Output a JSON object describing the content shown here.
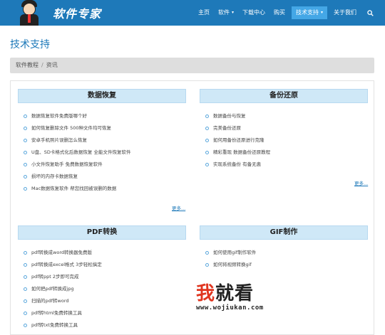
{
  "header": {
    "logo_text": "软件专家",
    "nav": [
      {
        "label": "主页",
        "dropdown": false,
        "active": false
      },
      {
        "label": "软件",
        "dropdown": true,
        "active": false
      },
      {
        "label": "下载中心",
        "dropdown": false,
        "active": false
      },
      {
        "label": "购买",
        "dropdown": false,
        "active": false
      },
      {
        "label": "技术支持",
        "dropdown": true,
        "active": true
      },
      {
        "label": "关于我们",
        "dropdown": false,
        "active": false
      }
    ],
    "search_icon": "search-icon",
    "colors": {
      "bar": "#1e79b9",
      "active": "#44a7e6"
    }
  },
  "page": {
    "title": "技术支持",
    "breadcrumb": {
      "first": "软件教程",
      "separator": "/",
      "second": "资讯"
    }
  },
  "sections": {
    "data_recovery": {
      "title": "数据恢复",
      "items": [
        "数据恢复软件免费版哪个好",
        "如何恢复删除文件 500种文件均可恢复",
        "安卓手机照片误删怎么恢复",
        "U盘、SD卡格式化后数据恢复 全能文件恢复软件",
        "小文件恢复助手 免费数据恢复软件",
        "损坏的内存卡数据恢复",
        "Mac数据恢复软件 帮您找回被误删的数据"
      ],
      "more": "更多..."
    },
    "backup_restore": {
      "title": "备份还原",
      "items": [
        "数据备份与恢复",
        "完美备份还原",
        "如何用备份还原进行克隆",
        "精彩重现 数据备份还原教程",
        "实现系统备份 有备无患"
      ],
      "more": "更多..."
    },
    "pdf_convert": {
      "title": "PDF转换",
      "items": [
        "pdf转换成word转换器免费版",
        "pdf转换成excel格式 3步轻松搞定",
        "pdf转ppt 2步即可完成",
        "如何把pdf转换成jpg",
        "扫描的pdf转word",
        "pdf转html免费转换工具",
        "pdf转txt免费转换工具"
      ]
    },
    "gif_make": {
      "title": "GIF制作",
      "items": [
        "如何使用gif制作软件",
        "如何将视频转换gif"
      ]
    }
  },
  "watermark": {
    "big_part1": "我",
    "big_part2": "就看",
    "url": "www.wojiukan.com"
  }
}
